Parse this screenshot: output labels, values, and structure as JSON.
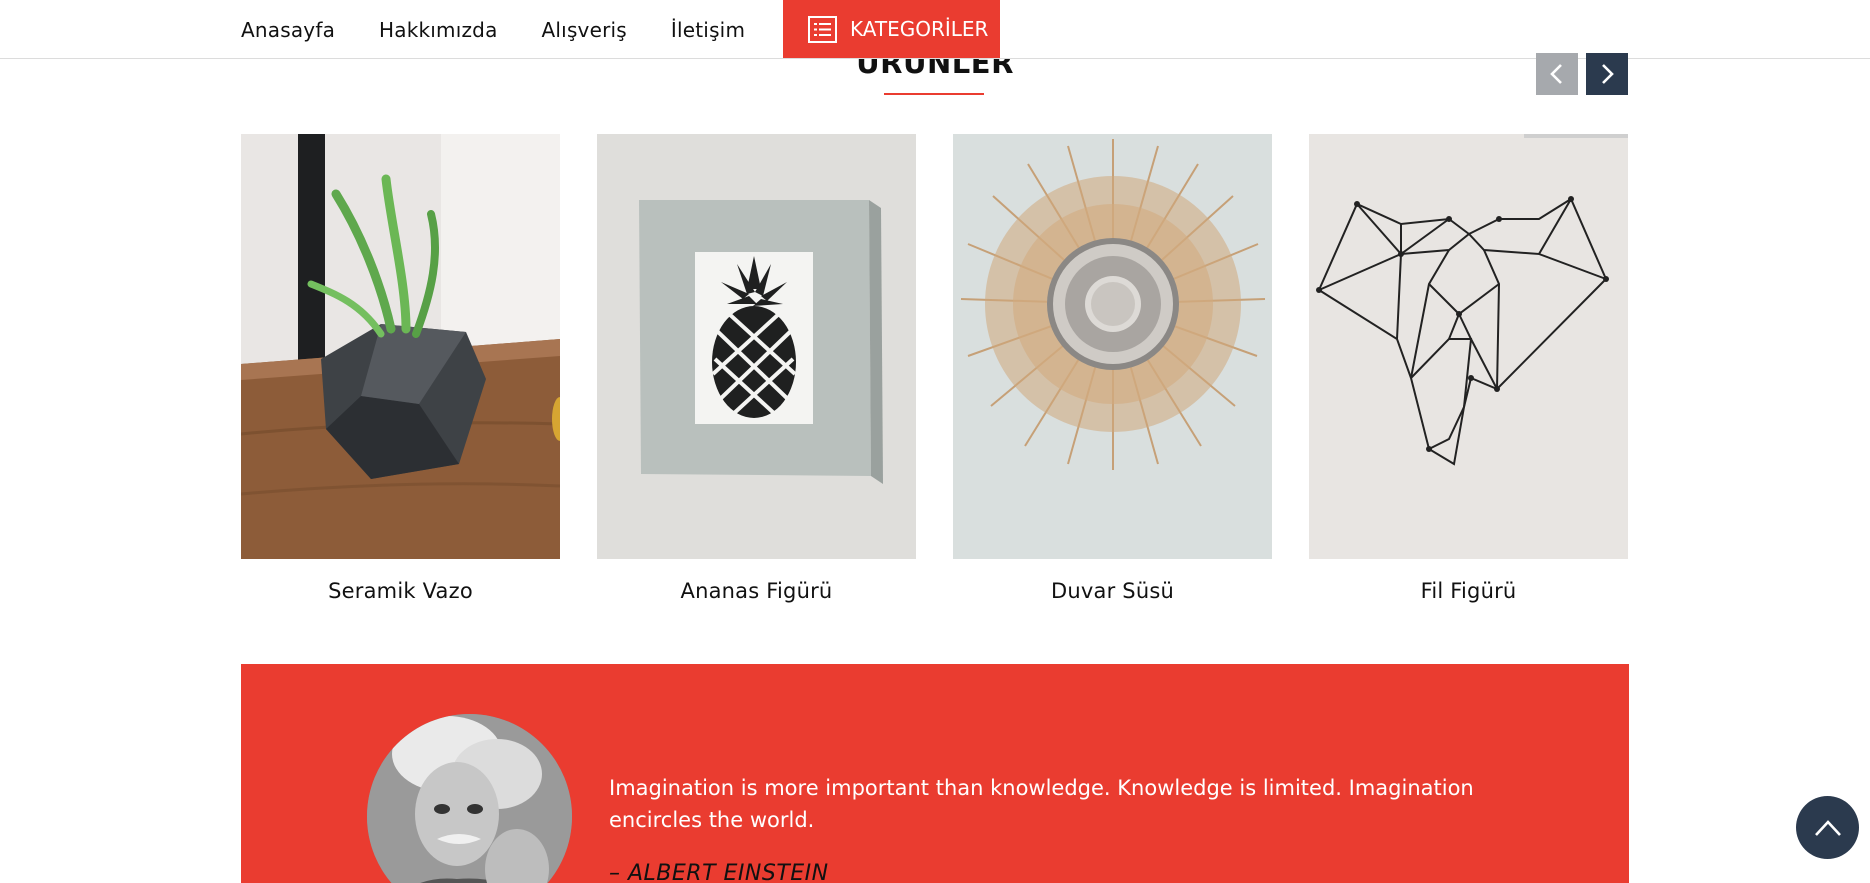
{
  "nav": {
    "links": [
      "Anasayfa",
      "Hakkımızda",
      "Alışveriş",
      "İletişim"
    ],
    "categories_label": "KATEGORİLER"
  },
  "section": {
    "title": "ÜRÜNLER"
  },
  "products": [
    {
      "name": "Seramik Vazo"
    },
    {
      "name": "Ananas Figürü"
    },
    {
      "name": "Duvar Süsü"
    },
    {
      "name": "Fil Figürü"
    }
  ],
  "quote": {
    "text": "Imagination is more important than knowledge. Knowledge is limited. Imagination encircles the world.",
    "author": "– ALBERT EINSTEIN"
  },
  "colors": {
    "accent": "#ea3c30",
    "dark": "#2b3a4e",
    "arrow_disabled": "#a6a9ad"
  },
  "icons": {
    "categories": "list-icon",
    "prev": "chevron-left-icon",
    "next": "chevron-right-icon",
    "to_top": "chevron-up-icon"
  }
}
